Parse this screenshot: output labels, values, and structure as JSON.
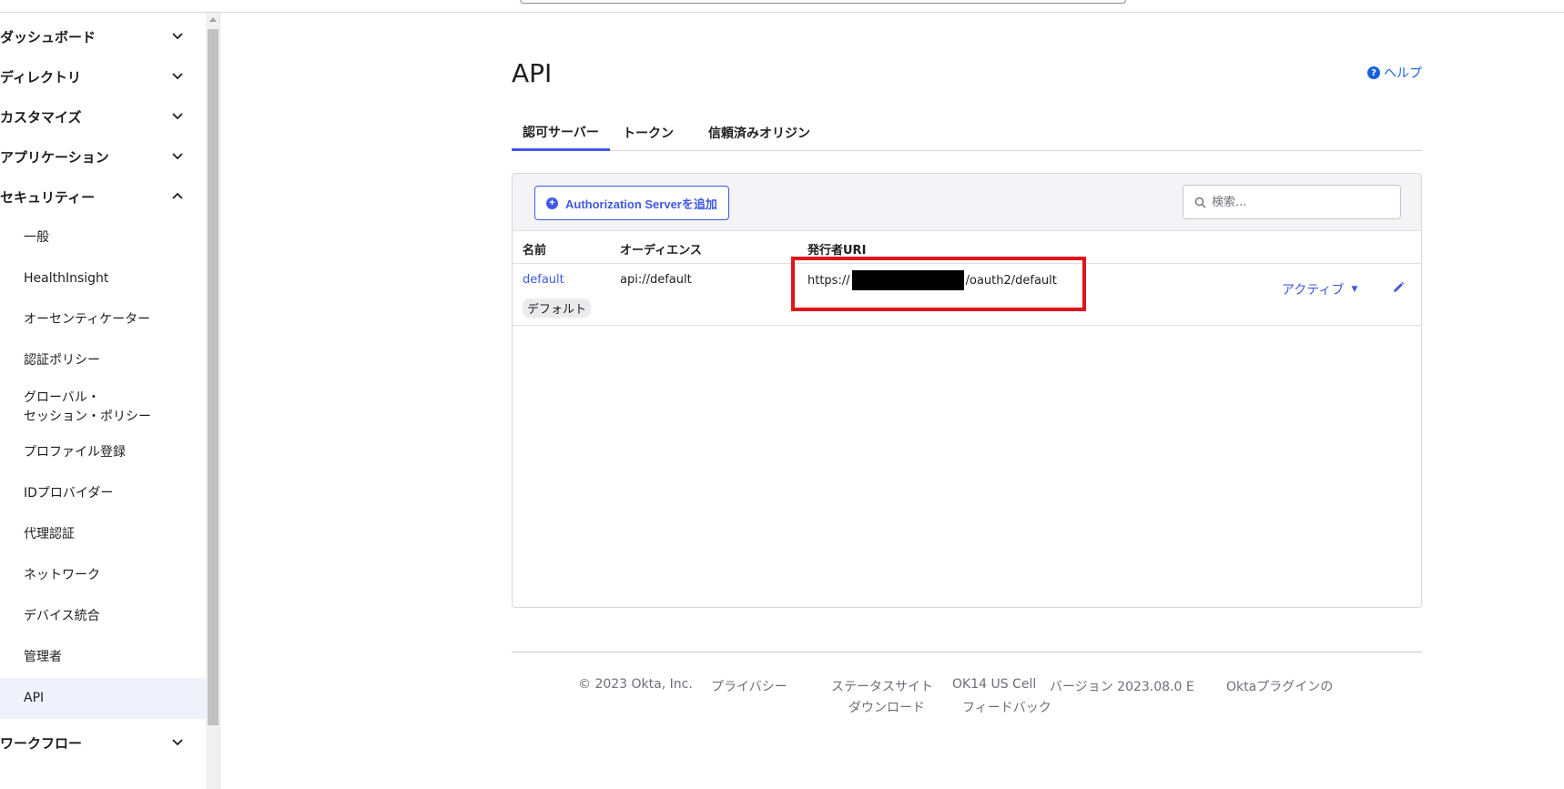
{
  "sidebar": {
    "sections": [
      {
        "label": "ダッシュボード",
        "state": "collapsed"
      },
      {
        "label": "ディレクトリ",
        "state": "collapsed"
      },
      {
        "label": "カスタマイズ",
        "state": "collapsed"
      },
      {
        "label": "アプリケーション",
        "state": "collapsed"
      },
      {
        "label": "セキュリティー",
        "state": "expanded"
      },
      {
        "label": "ワークフロー",
        "state": "collapsed"
      }
    ],
    "security_items": [
      {
        "label": "一般"
      },
      {
        "label": "HealthInsight"
      },
      {
        "label": "オーセンティケーター"
      },
      {
        "label": "認証ポリシー"
      },
      {
        "label": "グローバル・\nセッション・ポリシー"
      },
      {
        "label": "プロファイル登録"
      },
      {
        "label": "IDプロバイダー"
      },
      {
        "label": "代理認証"
      },
      {
        "label": "ネットワーク"
      },
      {
        "label": "デバイス統合"
      },
      {
        "label": "管理者"
      },
      {
        "label": "API",
        "active": true
      }
    ]
  },
  "page": {
    "title": "API",
    "help_label": "ヘルプ"
  },
  "tabs": [
    {
      "label": "認可サーバー",
      "active": true
    },
    {
      "label": "トークン"
    },
    {
      "label": "信頼済みオリジン"
    }
  ],
  "toolbar": {
    "add_button_label": "Authorization Serverを追加",
    "search_placeholder": "検索..."
  },
  "table": {
    "headers": [
      "名前",
      "オーディエンス",
      "発行者URI"
    ],
    "rows": [
      {
        "name": "default",
        "badge": "デフォルト",
        "audience": "api://default",
        "issuer_prefix": "https://",
        "issuer_suffix": "/oauth2/default",
        "status": "アクティブ"
      }
    ]
  },
  "footer": {
    "copyright": "© 2023 Okta, Inc.",
    "privacy": "プライバシー",
    "status_site": "ステータスサイト",
    "cell": "OK14 US Cell",
    "version": "バージョン 2023.08.0 E",
    "plugin": "Oktaプラグインの",
    "download": "ダウンロード",
    "feedback": "フィードバック"
  },
  "colors": {
    "accent": "#3f59e4",
    "highlight": "#e0151a",
    "active_nav_bg": "#f0f2fb"
  }
}
